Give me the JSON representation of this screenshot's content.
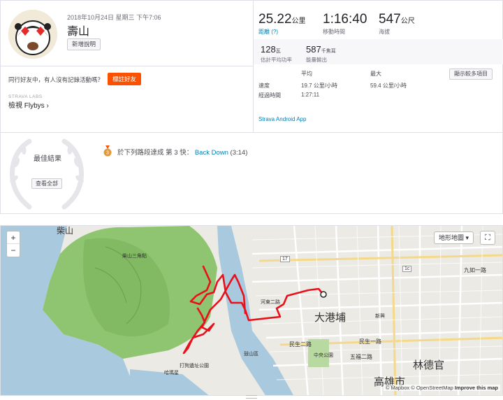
{
  "activity": {
    "date": "2018年10月24日 星期三 下午7:06",
    "title": "壽山",
    "add_description": "新增說明",
    "with_others": "同行好友中，有人沒有記錄活動嗎？",
    "tag_friends": "標註好友",
    "labs": "STRAVA LABS",
    "flybys": "檢視 Flybys ›"
  },
  "stats": {
    "distance": {
      "value": "25.22",
      "unit": "公里",
      "label": "距離 (?)"
    },
    "moving_time": {
      "value": "1:16:40",
      "label": "移動時間"
    },
    "elevation": {
      "value": "547",
      "unit": "公尺",
      "label": "海拔"
    },
    "avg_power": {
      "value": "128",
      "unit": "瓦",
      "label": "估計平均功率"
    },
    "energy": {
      "value": "587",
      "unit": "千焦耳",
      "label": "能量輸出"
    }
  },
  "details": {
    "col_avg": "平均",
    "col_max": "最大",
    "speed_label": "速度",
    "speed_avg": "19.7 公里/小時",
    "speed_max": "59.4 公里/小時",
    "elapsed_label": "經過時間",
    "elapsed_value": "1:27:11",
    "show_more": "顯示較多項目",
    "app": "Strava Android App"
  },
  "best": {
    "label": "最佳結果",
    "see_all": "查看全部",
    "achievement_prefix": "於下列路段達成 第 3 快：",
    "segment": "Back Down",
    "time": "(3:14)"
  },
  "map": {
    "zoom_in": "+",
    "zoom_out": "−",
    "map_type": "地形地圖 ▾",
    "fullscreen": "⛶",
    "labels": {
      "chaishan": "柴山",
      "shoushan_peak": "柴山三角點",
      "dagangpu": "大港埔",
      "lindeguan": "林德官",
      "kaohsiung": "高雄市",
      "park": "打狗遺址公園",
      "hamaxing": "哈瑪星",
      "minsheng": "民生二路",
      "minsheng1": "民生一路",
      "wufu": "五福二路",
      "xinxing": "新興區",
      "jiuru": "九如一路",
      "zhongshan": "中央公園",
      "gushan": "鼓山區",
      "road17": "17",
      "road1c": "1c",
      "heyi": "河東二路",
      "xinjing": "新興"
    },
    "attribution": "© Mapbox © OpenStreetMap",
    "improve": "Improve this map"
  },
  "colors": {
    "accent": "#fc5200",
    "link": "#007fb6",
    "route": "#e8101a",
    "land": "#eceae4",
    "sea": "#a9c9de",
    "park": "#8fc470"
  }
}
